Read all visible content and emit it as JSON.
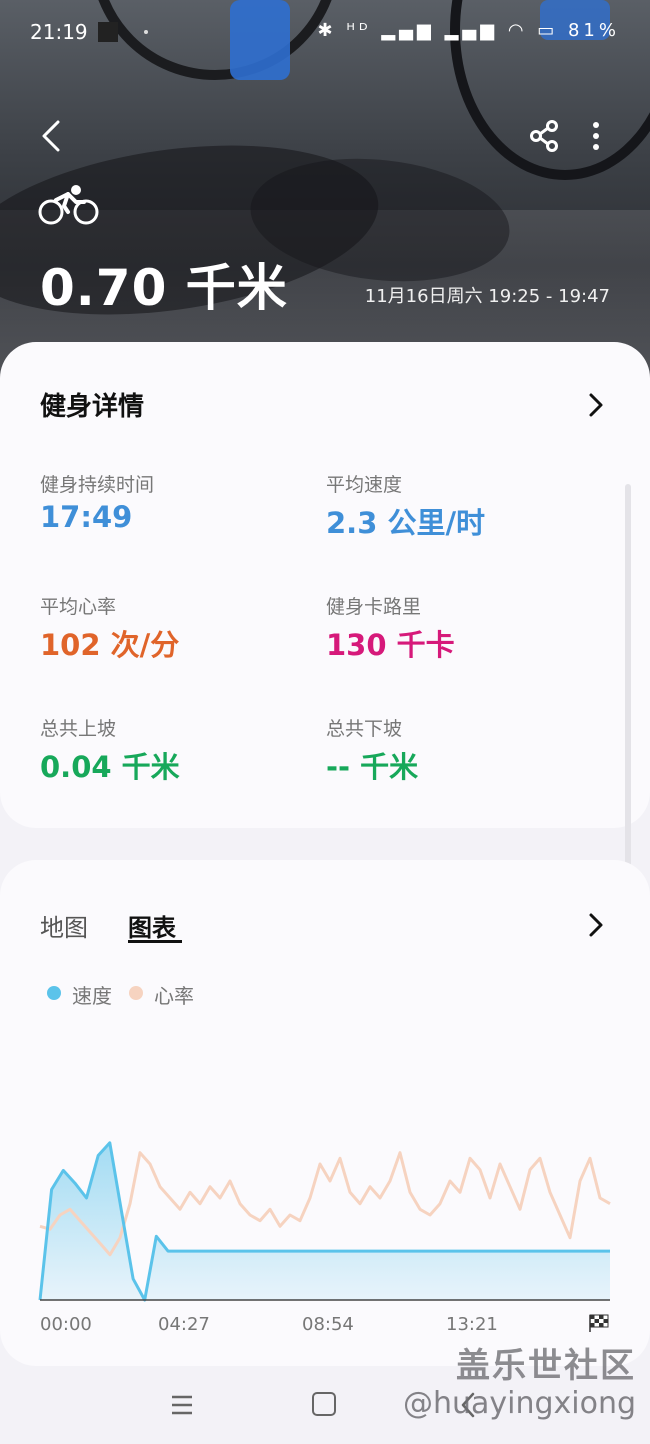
{
  "status_bar": {
    "time": "21:19",
    "icons": "✱ ᴴᴰ ▂▄▆ ▂▄▆ ◠ ▭ 81%"
  },
  "header": {
    "distance": "0.70 千米",
    "date_range": "11月16日周六 19:25 - 19:47"
  },
  "detail_card": {
    "title": "健身详情",
    "metrics": [
      {
        "label": "健身持续时间",
        "value": "17:49",
        "color": "#3f8fd8"
      },
      {
        "label": "平均速度",
        "value": "2.3 公里/时",
        "color": "#3f8fd8"
      },
      {
        "label": "平均心率",
        "value": "102 次/分",
        "color": "#e0642a"
      },
      {
        "label": "健身卡路里",
        "value": "130 千卡",
        "color": "#d6197a"
      },
      {
        "label": "总共上坡",
        "value": "0.04 千米",
        "color": "#17a85a"
      },
      {
        "label": "总共下坡",
        "value": "-- 千米",
        "color": "#17a85a"
      }
    ]
  },
  "chart_card": {
    "tabs": [
      {
        "label": "地图",
        "active": false
      },
      {
        "label": "图表",
        "active": true
      }
    ],
    "legend": [
      {
        "label": "速度",
        "color": "#5bc3ea"
      },
      {
        "label": "心率",
        "color": "#f6d3c0"
      }
    ]
  },
  "chart_data": {
    "type": "area",
    "x_ticks": [
      "00:00",
      "04:27",
      "08:54",
      "13:21"
    ],
    "series": [
      {
        "name": "速度",
        "values": [
          0,
          5.2,
          6.1,
          5.5,
          4.8,
          6.8,
          7.4,
          4.2,
          1.0,
          0,
          3.0,
          2.3,
          2.3,
          2.3,
          2.3,
          2.3,
          2.3,
          2.3,
          2.3,
          2.3,
          2.3,
          2.3,
          2.3,
          2.3,
          2.3,
          2.3,
          2.3,
          2.3,
          2.3,
          2.3,
          2.3,
          2.3,
          2.3,
          2.3,
          2.3,
          2.3,
          2.3,
          2.3,
          2.3,
          2.3,
          2.3,
          2.3,
          2.3,
          2.3,
          2.3,
          2.3,
          2.3,
          2.3,
          2.3,
          2.3
        ]
      },
      {
        "name": "心率",
        "values": [
          96,
          95,
          100,
          102,
          98,
          94,
          90,
          86,
          92,
          104,
          122,
          118,
          110,
          106,
          102,
          108,
          104,
          110,
          106,
          112,
          104,
          100,
          98,
          102,
          96,
          100,
          98,
          106,
          118,
          112,
          120,
          108,
          104,
          110,
          106,
          112,
          122,
          108,
          102,
          100,
          104,
          112,
          108,
          120,
          116,
          106,
          118,
          110,
          102,
          116,
          120,
          108,
          100,
          92,
          112,
          120,
          106,
          104
        ]
      }
    ]
  },
  "navbar": {},
  "watermark": {
    "line1": "盖乐世社区",
    "line2": "@huayingxiong"
  }
}
